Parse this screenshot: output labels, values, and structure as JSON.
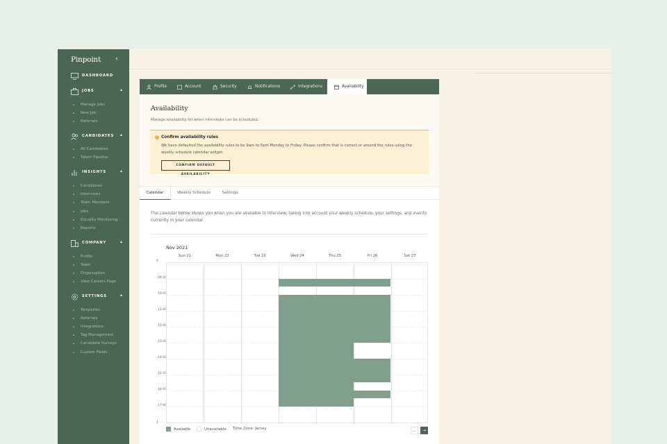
{
  "app": {
    "brand": "Pinpoint",
    "collapse_icon": "chevron-left-icon"
  },
  "sidebar": {
    "sections": [
      {
        "label": "DASHBOARD",
        "icon": "monitor-icon",
        "items": []
      },
      {
        "label": "JOBS",
        "icon": "briefcase-icon",
        "items": [
          "Manage Jobs",
          "New Job",
          "Referrals"
        ]
      },
      {
        "label": "CANDIDATES",
        "icon": "users-icon",
        "items": [
          "All Candidates",
          "Talent Pipeline"
        ]
      },
      {
        "label": "INSIGHTS",
        "icon": "bar-chart-icon",
        "items": [
          "Candidates",
          "Interviews",
          "Team Members",
          "Jobs",
          "Equality Monitoring",
          "Reports"
        ]
      },
      {
        "label": "COMPANY",
        "icon": "building-icon",
        "items": [
          "Profile",
          "Team",
          "Organisation",
          "View Careers Page"
        ]
      },
      {
        "label": "SETTINGS",
        "icon": "gear-icon",
        "items": [
          "Templates",
          "Referrals",
          "Integrations",
          "Tag Management",
          "Candidate Surveys",
          "Custom Fields"
        ]
      }
    ]
  },
  "tabs": [
    "Profile",
    "Account",
    "Security",
    "Notifications",
    "Integrations",
    "Availability"
  ],
  "active_tab": "Availability",
  "availability": {
    "title": "Availability",
    "description": "Manage availability for when interviews can be scheduled.",
    "alert": {
      "title": "Confirm availability rules",
      "body": "We have defaulted the availability rules to be 9am to 5pm Monday to Friday. Please confirm that is correct or amend the rules using the weekly schedule calendar widget.",
      "button": "CONFIRM DEFAULT AVAILABILITY"
    }
  },
  "subtabs": [
    "Calendar",
    "Weekly Schedule",
    "Settings"
  ],
  "calendar": {
    "description": "The calendar below shows you when you are available to interview, taking into account your weekly schedule, your settings, and events currently in your calendar",
    "month": "Nov 2021",
    "days": [
      "Sun 21",
      "Mon 22",
      "Tue 23",
      "Wed 24",
      "Thu 25",
      "Fri 26",
      "Sat 27"
    ],
    "times": [
      "09:00",
      "10:00",
      "11:00",
      "12:00",
      "13:00",
      "14:00",
      "15:00",
      "16:00",
      "17:00"
    ],
    "legend": {
      "available": "Available",
      "unavailable": "Unavailable",
      "timezone": "Time Zone: Jersey"
    },
    "colors": {
      "available": "#809f8c",
      "accent": "#4b6654",
      "warning": "#e9b95a"
    }
  }
}
